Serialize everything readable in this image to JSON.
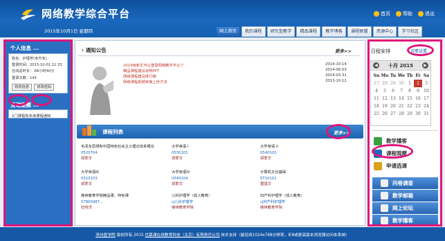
{
  "header": {
    "title": "网络教学综合平台",
    "date": "2015年10月1日 星期四",
    "links": [
      {
        "label": "首页",
        "icon": "home-icon"
      },
      {
        "label": "帮助",
        "icon": "help-icon"
      },
      {
        "label": "退出",
        "icon": "exit-icon"
      }
    ]
  },
  "nav": {
    "tabs": [
      "网上首页",
      "我的课程",
      "研究型教学",
      "精品课程",
      "教学博客",
      "课程联盟",
      "资源中心",
      "学习社区"
    ],
    "active": 0
  },
  "left": {
    "personal_title": "个人信息",
    "info_lines": [
      "姓名：护理学(专升本)",
      "登录时间：2015-10-01 11:33",
      "在线总时长： 66小时40分",
      "登录次数：143"
    ],
    "btn_edit_info": "修改信息",
    "btn_edit_pwd": "修改密码",
    "reminder_title": "互动提醒",
    "reminder_text": "2门课程有未读课程通知"
  },
  "notice": {
    "title": "通知公告",
    "more": "更多>>",
    "items": [
      {
        "text": "2014级新生可以登录网络教学平台了",
        "date": "2014-10-14"
      },
      {
        "text": "精品课程建设说明PPT",
        "date": "2014-06-03"
      },
      {
        "text": "网络课程建设排行榜",
        "date": "2014-03-31"
      },
      {
        "text": "网络课程视频转换上传方法",
        "date": "2013-10-12"
      }
    ]
  },
  "courses": {
    "title": "课程列表",
    "more": "更多>>",
    "rows": [
      [
        {
          "name": "毛泽东思想和中国特色社会主义理论体系概论",
          "code": "0520704",
          "teacher": "郑爱华"
        },
        {
          "name": "大学英语 I",
          "code": "0530101",
          "teacher": "郑爱华"
        },
        {
          "name": "大学英语 II",
          "code": "0540102",
          "teacher": "郑爱华"
        }
      ],
      [
        {
          "name": "大学英语III",
          "code": "0510103",
          "teacher": "郑爱华"
        },
        {
          "name": "大学英语IV",
          "code": "0540104",
          "teacher": "郑爱华"
        },
        {
          "name": "计算机文化基础",
          "code": "0T10101",
          "teacher": "雷国华"
        }
      ],
      [
        {
          "name": "继续教育学院精品课、特色课",
          "code": "57800987...",
          "teacher": "杜鸣洋"
        },
        {
          "name": "儿科护理学（成人教育）",
          "code": "cj儿科护理学",
          "teacher": "继续教育学院"
        },
        {
          "name": "妇产科护理学（成人教育）",
          "code": "cj妇产科护理学",
          "teacher": "继续教育学院"
        }
      ]
    ]
  },
  "schedule": {
    "title": "日程安排",
    "settings": "详情设置",
    "month_label": "十月 2015",
    "weekdays": [
      "Su",
      "Mo",
      "Tu",
      "We",
      "Th",
      "Fr",
      "Sa"
    ],
    "weeks": [
      [
        "27",
        "28",
        "29",
        "30",
        "1",
        "2",
        "3"
      ],
      [
        "4",
        "5",
        "6",
        "7",
        "8",
        "9",
        "10"
      ],
      [
        "11",
        "12",
        "13",
        "14",
        "15",
        "16",
        "17"
      ],
      [
        "18",
        "19",
        "20",
        "21",
        "22",
        "23",
        "24"
      ],
      [
        "25",
        "26",
        "27",
        "28",
        "29",
        "30",
        "31"
      ]
    ],
    "today": "2"
  },
  "quick": {
    "white_buttons": [
      {
        "label": "教学播客",
        "icon": "podcast-icon",
        "color": "#3a9f42"
      },
      {
        "label": "课程观摩",
        "icon": "observe-icon",
        "color": "#1d6bb8"
      },
      {
        "label": "申请选课",
        "icon": "enroll-icon",
        "color": "#d9a21a"
      }
    ],
    "blue_buttons": [
      {
        "label": "问卷调查",
        "icon": "survey-icon"
      },
      {
        "label": "教学邮箱",
        "icon": "mail-icon"
      },
      {
        "label": "网上论坛",
        "icon": "forum-icon"
      },
      {
        "label": "教学播客",
        "icon": "podcast-icon"
      }
    ]
  },
  "footer": {
    "prefix": "",
    "school_link": "滨州医学院",
    "mid": " 版权所有 2015 ",
    "company_link": "优慕课在线教育科技（北京）有限责任公司",
    "suffix": " 技术支持（最佳用1024x768分辨率，IE8或更高版本浏览器访问本系统）"
  },
  "colors": {
    "accent": "#1a68bd",
    "highlight": "#e0157a"
  }
}
